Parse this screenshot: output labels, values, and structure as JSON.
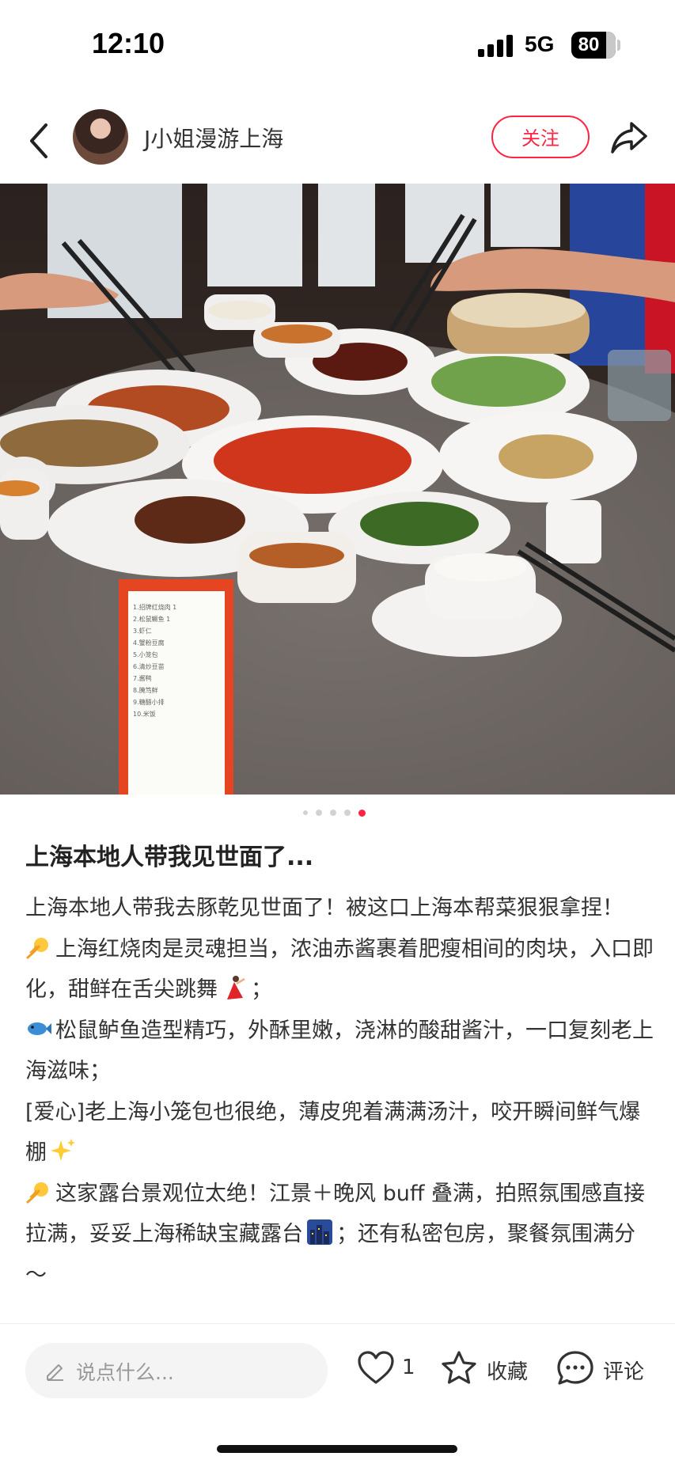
{
  "status_bar": {
    "time": "12:10",
    "network": "5G",
    "battery": "80"
  },
  "header": {
    "author": "J小姐漫游上海",
    "follow_label": "关注"
  },
  "gallery": {
    "total": 5,
    "current": 5
  },
  "menu_card": {
    "lines": [
      "1.招牌红烧肉 1",
      "2.松鼠鳜鱼 1",
      "3.虾仁",
      "4.蟹粉豆腐",
      "5.小笼包",
      "6.清炒豆苗",
      "7.酱鸭",
      "8.腌笃鲜",
      "9.糖醋小排",
      "10.米饭"
    ]
  },
  "post": {
    "title": "上海本地人带我见世面了...",
    "paragraphs": [
      {
        "emoji": "",
        "text": "上海本地人带我去豚乾见世面了！被这口上海本帮菜狠狠拿捏！"
      },
      {
        "emoji": "sparkle-icon",
        "text": "上海红烧肉是灵魂担当，浓油赤酱裹着肥瘦相间的肉块，入口即化，甜鲜在舌尖跳舞",
        "emoji_end": "dancer-icon",
        "suffix": "；"
      },
      {
        "emoji": "fish-icon",
        "text": "松鼠鲈鱼造型精巧，外酥里嫩，浇淋的酸甜酱汁，一口复刻老上海滋味；"
      },
      {
        "emoji": "",
        "text": "[爱心]老上海小笼包也很绝，薄皮兜着满满汤汁，咬开瞬间鲜气爆棚",
        "emoji_end": "sparkles-icon"
      },
      {
        "emoji": "sparkle-icon",
        "text": "这家露台景观位太绝！江景＋晚风 buff 叠满，拍照氛围感直接拉满，妥妥上海稀缺宝藏露台",
        "emoji_end": "night-city-icon",
        "suffix": "；还有私密包房，聚餐氛围满分～"
      }
    ]
  },
  "bottom_bar": {
    "comment_placeholder": "说点什么...",
    "like_count": "1",
    "collect_label": "收藏",
    "comment_label": "评论"
  },
  "colors": {
    "accent": "#ff2442",
    "text": "#333333",
    "muted": "#999999"
  }
}
